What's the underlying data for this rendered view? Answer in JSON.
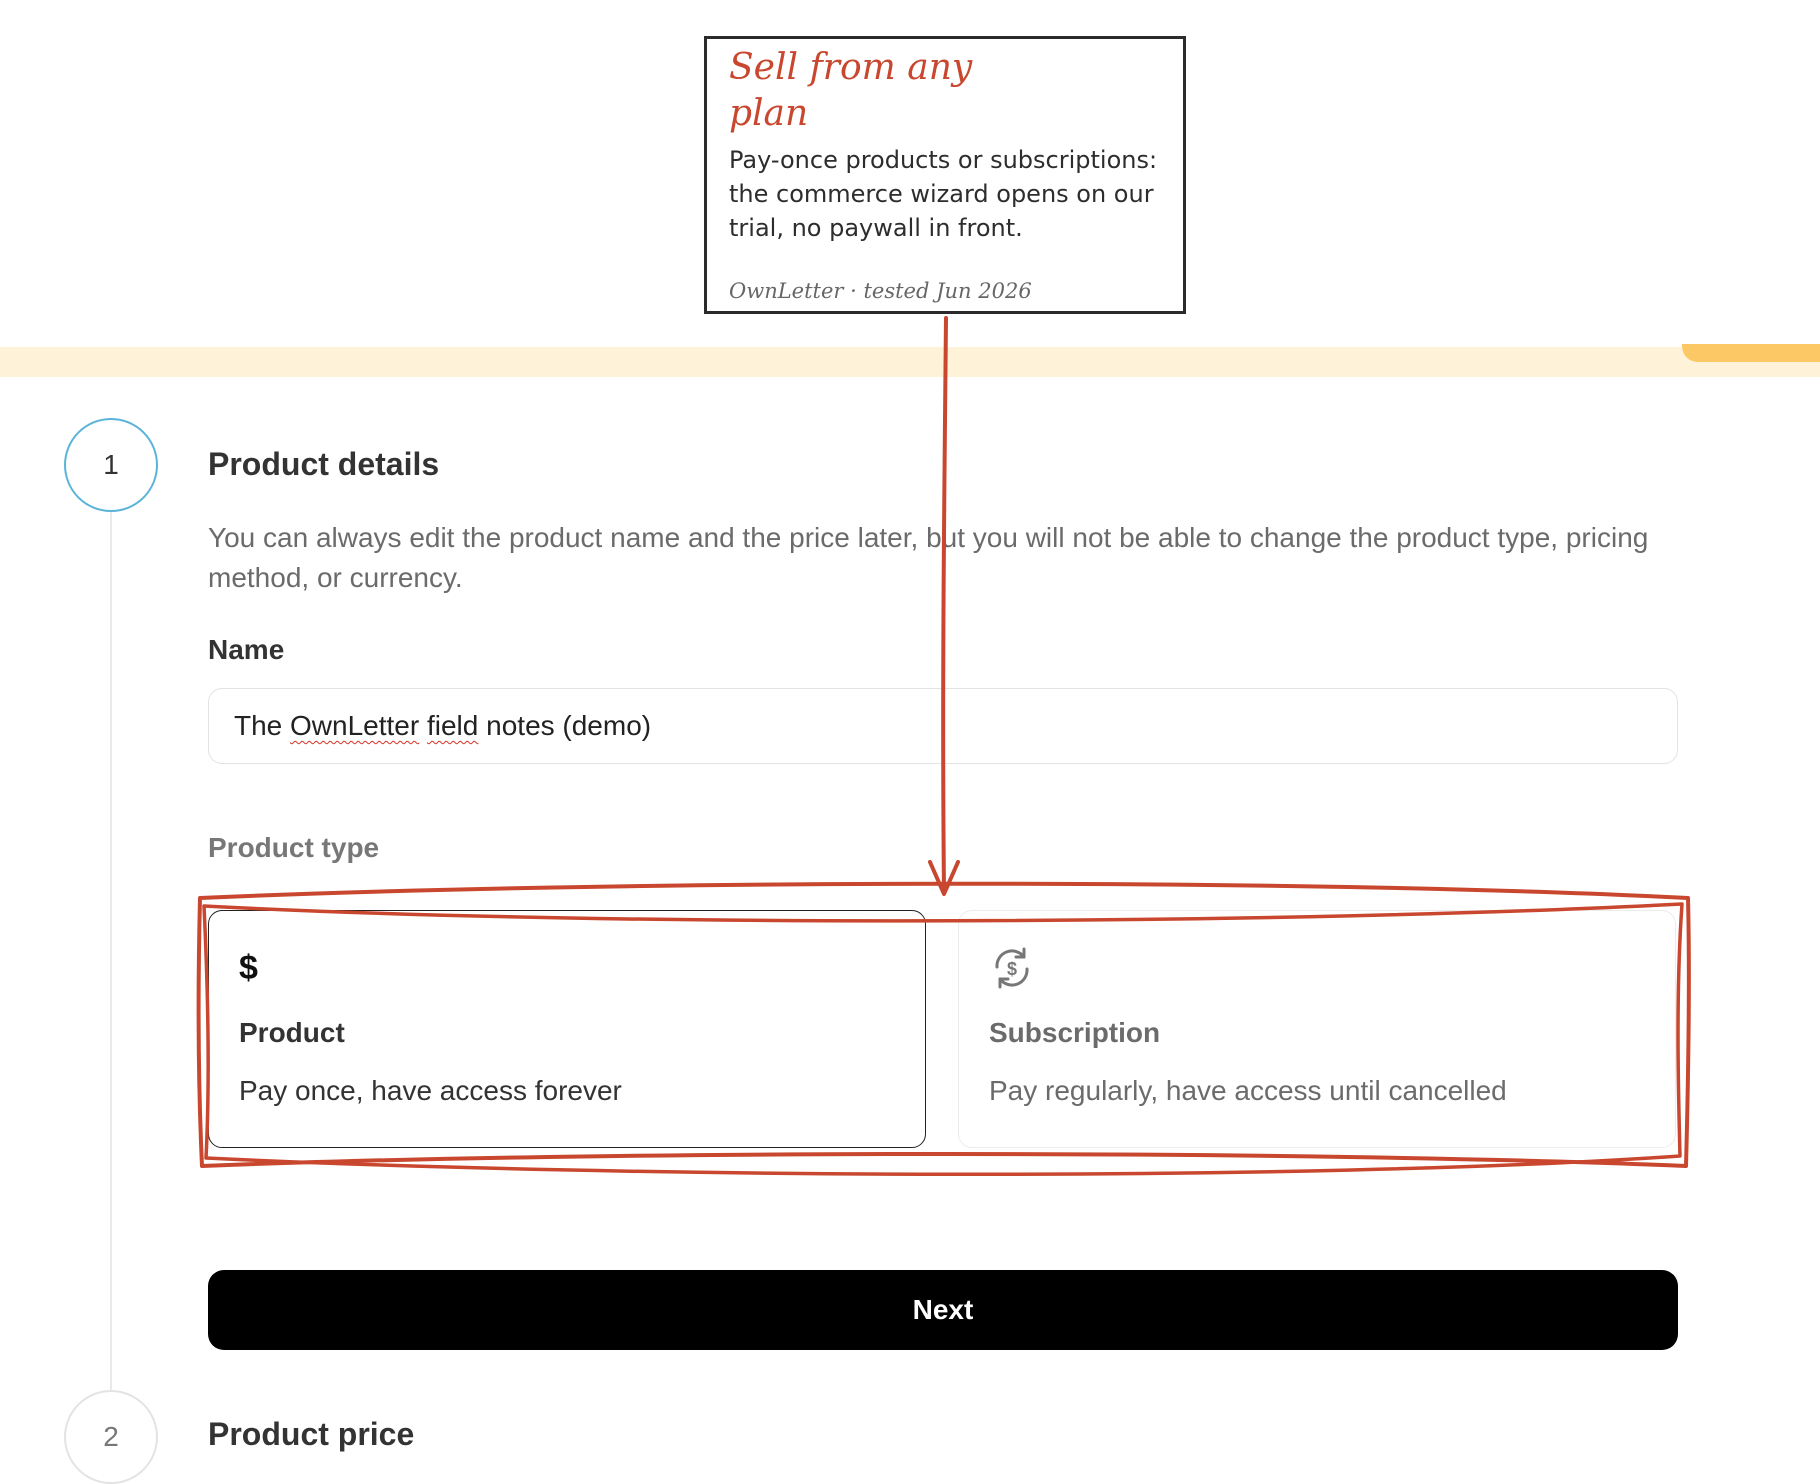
{
  "steps": [
    {
      "number": "1",
      "title": "Product details"
    },
    {
      "number": "2",
      "title": "Product price"
    }
  ],
  "details": {
    "description": "You can always edit the product name and the price later, but you will not be able to change the product type, pricing method, or currency.",
    "name_label": "Name",
    "name_value": "The OwnLetter field notes (demo)",
    "name_parts": {
      "pre": "The ",
      "word1": "OwnLetter",
      "mid": " ",
      "word2": "field",
      "post": " notes (demo)"
    },
    "type_label": "Product type"
  },
  "product_types": [
    {
      "title": "Product",
      "description": "Pay once, have access forever",
      "icon": "dollar-icon",
      "selected": true
    },
    {
      "title": "Subscription",
      "description": "Pay regularly, have access until cancelled",
      "icon": "recurring-dollar-icon",
      "selected": false
    }
  ],
  "next_label": "Next",
  "annotation": {
    "title": "Sell from any plan",
    "body": "Pay-once products or subscriptions: the commerce wizard opens on our trial, no paywall in front.",
    "source": "OwnLetter · tested Jun 2026"
  },
  "colors": {
    "annotation_red": "#c8472e",
    "banner": "#fef2d8",
    "banner_tab": "#fbc865",
    "step_active": "#5bb4d8"
  }
}
